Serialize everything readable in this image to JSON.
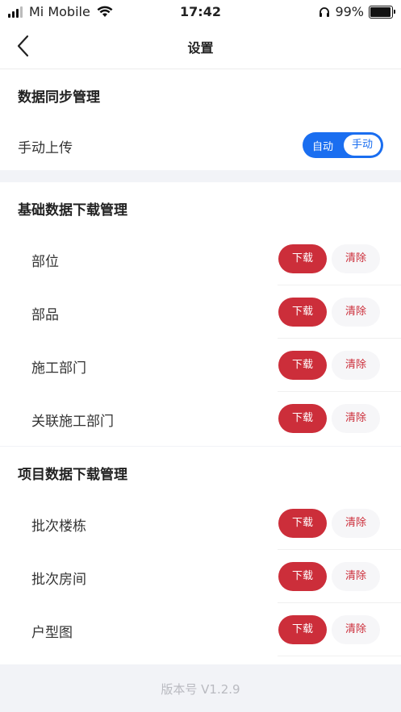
{
  "status_bar": {
    "carrier": "Mi Mobile",
    "time": "17:42",
    "battery": "99%"
  },
  "nav": {
    "title": "设置"
  },
  "sync": {
    "title": "数据同步管理",
    "row_label": "手动上传",
    "toggle_auto": "自动",
    "toggle_manual": "手动"
  },
  "basic": {
    "title": "基础数据下载管理",
    "items": [
      {
        "label": "部位",
        "download": "下载",
        "clear": "清除"
      },
      {
        "label": "部品",
        "download": "下载",
        "clear": "清除"
      },
      {
        "label": "施工部门",
        "download": "下载",
        "clear": "清除"
      },
      {
        "label": "关联施工部门",
        "download": "下载",
        "clear": "清除"
      }
    ]
  },
  "project": {
    "title": "项目数据下载管理",
    "items": [
      {
        "label": "批次楼栋",
        "download": "下载",
        "clear": "清除"
      },
      {
        "label": "批次房间",
        "download": "下载",
        "clear": "清除"
      },
      {
        "label": "户型图",
        "download": "下载",
        "clear": "清除"
      }
    ]
  },
  "version": "版本号 V1.2.9"
}
